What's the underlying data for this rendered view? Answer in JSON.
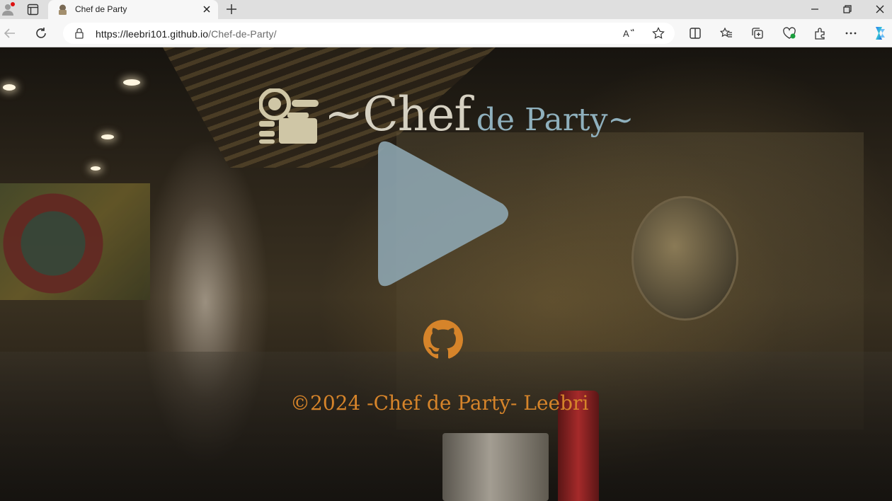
{
  "browser": {
    "tab_title": "Chef de Party",
    "url_domain": "https://leebri101.github.io",
    "url_path": "/Chef-de-Party/"
  },
  "page": {
    "title_main": "~Chef",
    "title_sub": "de Party~",
    "footer": "©2024 -Chef de Party- Leebri",
    "colors": {
      "title_main": "#d6d1c2",
      "title_sub": "#8fb0bd",
      "play_button": "#8fa9b4",
      "github_icon": "#d6842a",
      "footer_text": "#d6842a"
    }
  },
  "icons": {
    "logo": "chef-logo-icon",
    "play": "play-icon",
    "github": "github-icon"
  }
}
